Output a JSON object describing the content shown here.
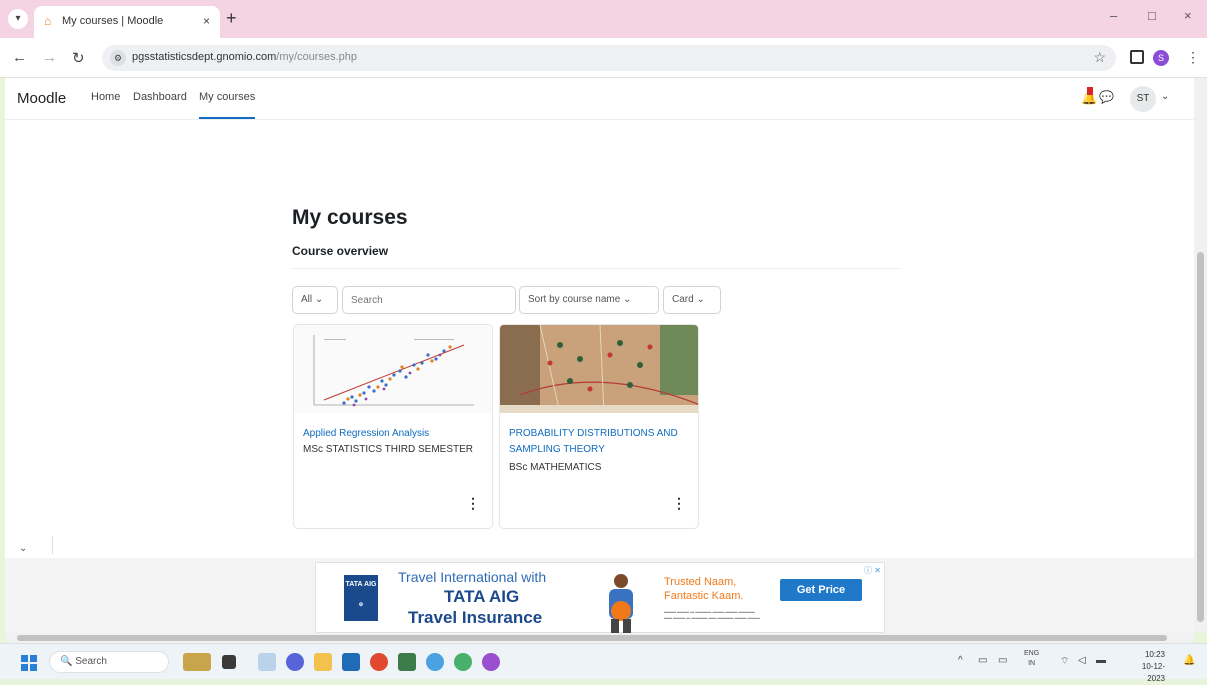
{
  "browser": {
    "tab_title": "My courses | Moodle",
    "tab_menu_icon": "chevron-down-icon",
    "new_tab": "+",
    "close_tab": "×",
    "window_controls": [
      "–",
      "□",
      "×"
    ],
    "url_host": "pgsstatisticsdept.gnomio.com",
    "url_path": "/my/courses.php"
  },
  "moodle_nav": {
    "brand": "Moodle",
    "links": [
      "Home",
      "Dashboard",
      "My courses"
    ],
    "active_link": "My courses",
    "user_initials": "ST"
  },
  "main": {
    "page_title": "My courses",
    "section_title": "Course overview",
    "filter_value": "All",
    "search_placeholder": "Search",
    "sort_value": "Sort by course name",
    "view_value": "Card"
  },
  "courses": [
    {
      "name": "Applied Regression Analysis",
      "category": "MSc STATISTICS THIRD SEMESTER"
    },
    {
      "name": "PROBABILITY DISTRIBUTIONS AND SAMPLING THEORY",
      "category": "BSc MATHEMATICS"
    }
  ],
  "ad": {
    "line1": "Travel International with",
    "line2": "TATA AIG",
    "line3": "Travel Insurance",
    "logo_text": "TATA AIG",
    "tagline": "Trusted Naam, Fantastic Kaam.",
    "cta": "Get Price",
    "choices": "ⓘ ✕"
  },
  "taskbar": {
    "search_label": "Search",
    "lang": "ENG",
    "lang_sub": "IN",
    "time": "10:23",
    "date": "10-12-2023"
  },
  "colors": {
    "accent": "#0f6cbf",
    "tab_strip": "#f4d3e3",
    "frame": "#e9f5d8"
  }
}
